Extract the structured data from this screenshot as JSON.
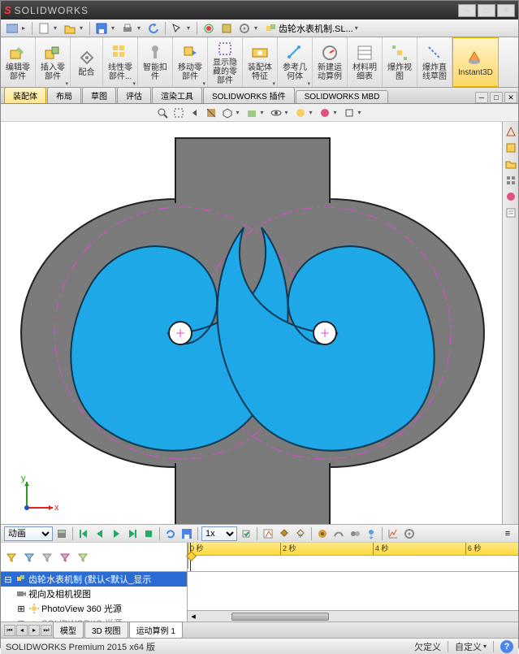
{
  "titlebar": {
    "brand": "SOLIDWORKS"
  },
  "menubar": {
    "doc_title": "齿轮水表机制.SL..."
  },
  "ribbon": {
    "items": [
      {
        "label": "编辑零\n部件"
      },
      {
        "label": "插入零\n部件"
      },
      {
        "label": "配合"
      },
      {
        "label": "线性零\n部件..."
      },
      {
        "label": "智能扣\n件"
      },
      {
        "label": "移动零\n部件"
      },
      {
        "label": "显示隐\n藏的零\n部件"
      },
      {
        "label": "装配体\n特征"
      },
      {
        "label": "参考几\n何体"
      },
      {
        "label": "新建运\n动算例"
      },
      {
        "label": "材料明\n细表"
      },
      {
        "label": "爆炸视\n图"
      },
      {
        "label": "爆炸直\n线草图"
      },
      {
        "label": "Instant3D"
      }
    ]
  },
  "tabs": {
    "items": [
      {
        "label": "装配体",
        "active": true
      },
      {
        "label": "布局"
      },
      {
        "label": "草图"
      },
      {
        "label": "评估"
      },
      {
        "label": "渲染工具"
      },
      {
        "label": "SOLIDWORKS 插件"
      },
      {
        "label": "SOLIDWORKS MBD"
      }
    ]
  },
  "triad": {
    "x": "x",
    "y": "y"
  },
  "motion": {
    "type_label": "动画",
    "speed": "1x"
  },
  "timeline": {
    "ticks": [
      "0 秒",
      "2 秒",
      "4 秒",
      "6 秒"
    ]
  },
  "tree": {
    "root": "齿轮水表机制  (默认<默认_显示",
    "child1": "视向及相机视图",
    "child2": "PhotoView 360 光源",
    "child3": "SOLIDWORKS 光源"
  },
  "bottomtabs": {
    "items": [
      {
        "label": "模型"
      },
      {
        "label": "3D 视图"
      },
      {
        "label": "运动算例 1",
        "active": true
      }
    ]
  },
  "status": {
    "version": "SOLIDWORKS Premium 2015 x64 版",
    "under": "欠定义",
    "custom": "自定义"
  }
}
